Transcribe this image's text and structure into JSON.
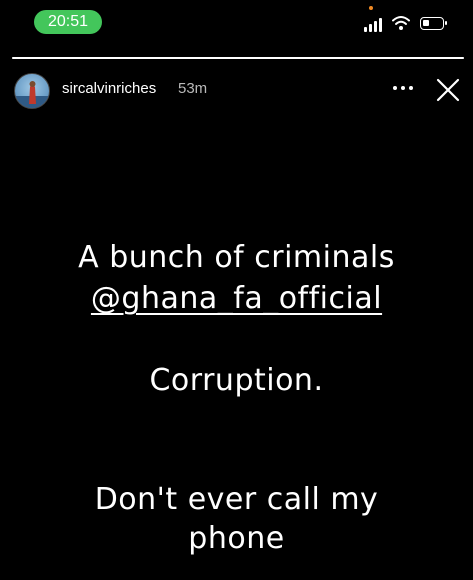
{
  "status_bar": {
    "time": "20:51",
    "time_pill_color": "#43c65b",
    "icons": [
      "signal-icon",
      "wifi-icon",
      "battery-icon"
    ]
  },
  "story_progress": {
    "fraction": 1.0
  },
  "header": {
    "username": "sircalvinriches",
    "time_ago": "53m",
    "more_icon": "more-icon",
    "close_icon": "close-icon"
  },
  "story": {
    "line1": "A bunch of criminals",
    "mention": "@ghana_fa_official",
    "line2": "Corruption.",
    "line3": "Don't ever call my",
    "line4": "phone"
  }
}
